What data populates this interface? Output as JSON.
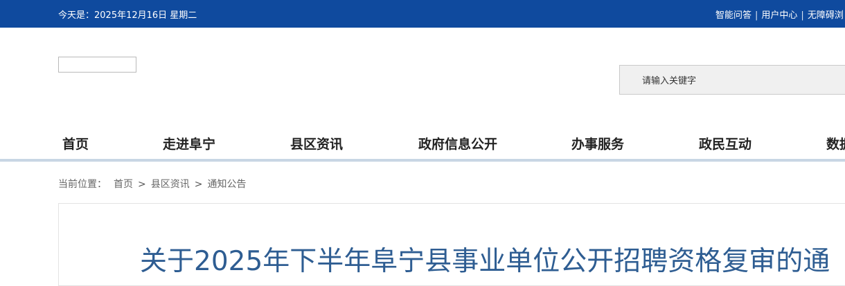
{
  "topbar": {
    "date_text": "今天是：2025年12月16日 星期二",
    "links": [
      "智能问答",
      "用户中心",
      "无障碍浏"
    ]
  },
  "search": {
    "placeholder": "请输入关键字"
  },
  "nav": {
    "items": [
      "首页",
      "走进阜宁",
      "县区资讯",
      "政府信息公开",
      "办事服务",
      "政民互动",
      "数据"
    ]
  },
  "breadcrumb": {
    "label": "当前位置：",
    "items": [
      "首页",
      "县区资讯",
      "通知公告"
    ],
    "separator": ">"
  },
  "article": {
    "title": "关于2025年下半年阜宁县事业单位公开招聘资格复审的通"
  },
  "colors": {
    "topbar_bg": "#0f4a9e",
    "title": "#2e5d92",
    "nav_rule": "#c8d6e4"
  }
}
